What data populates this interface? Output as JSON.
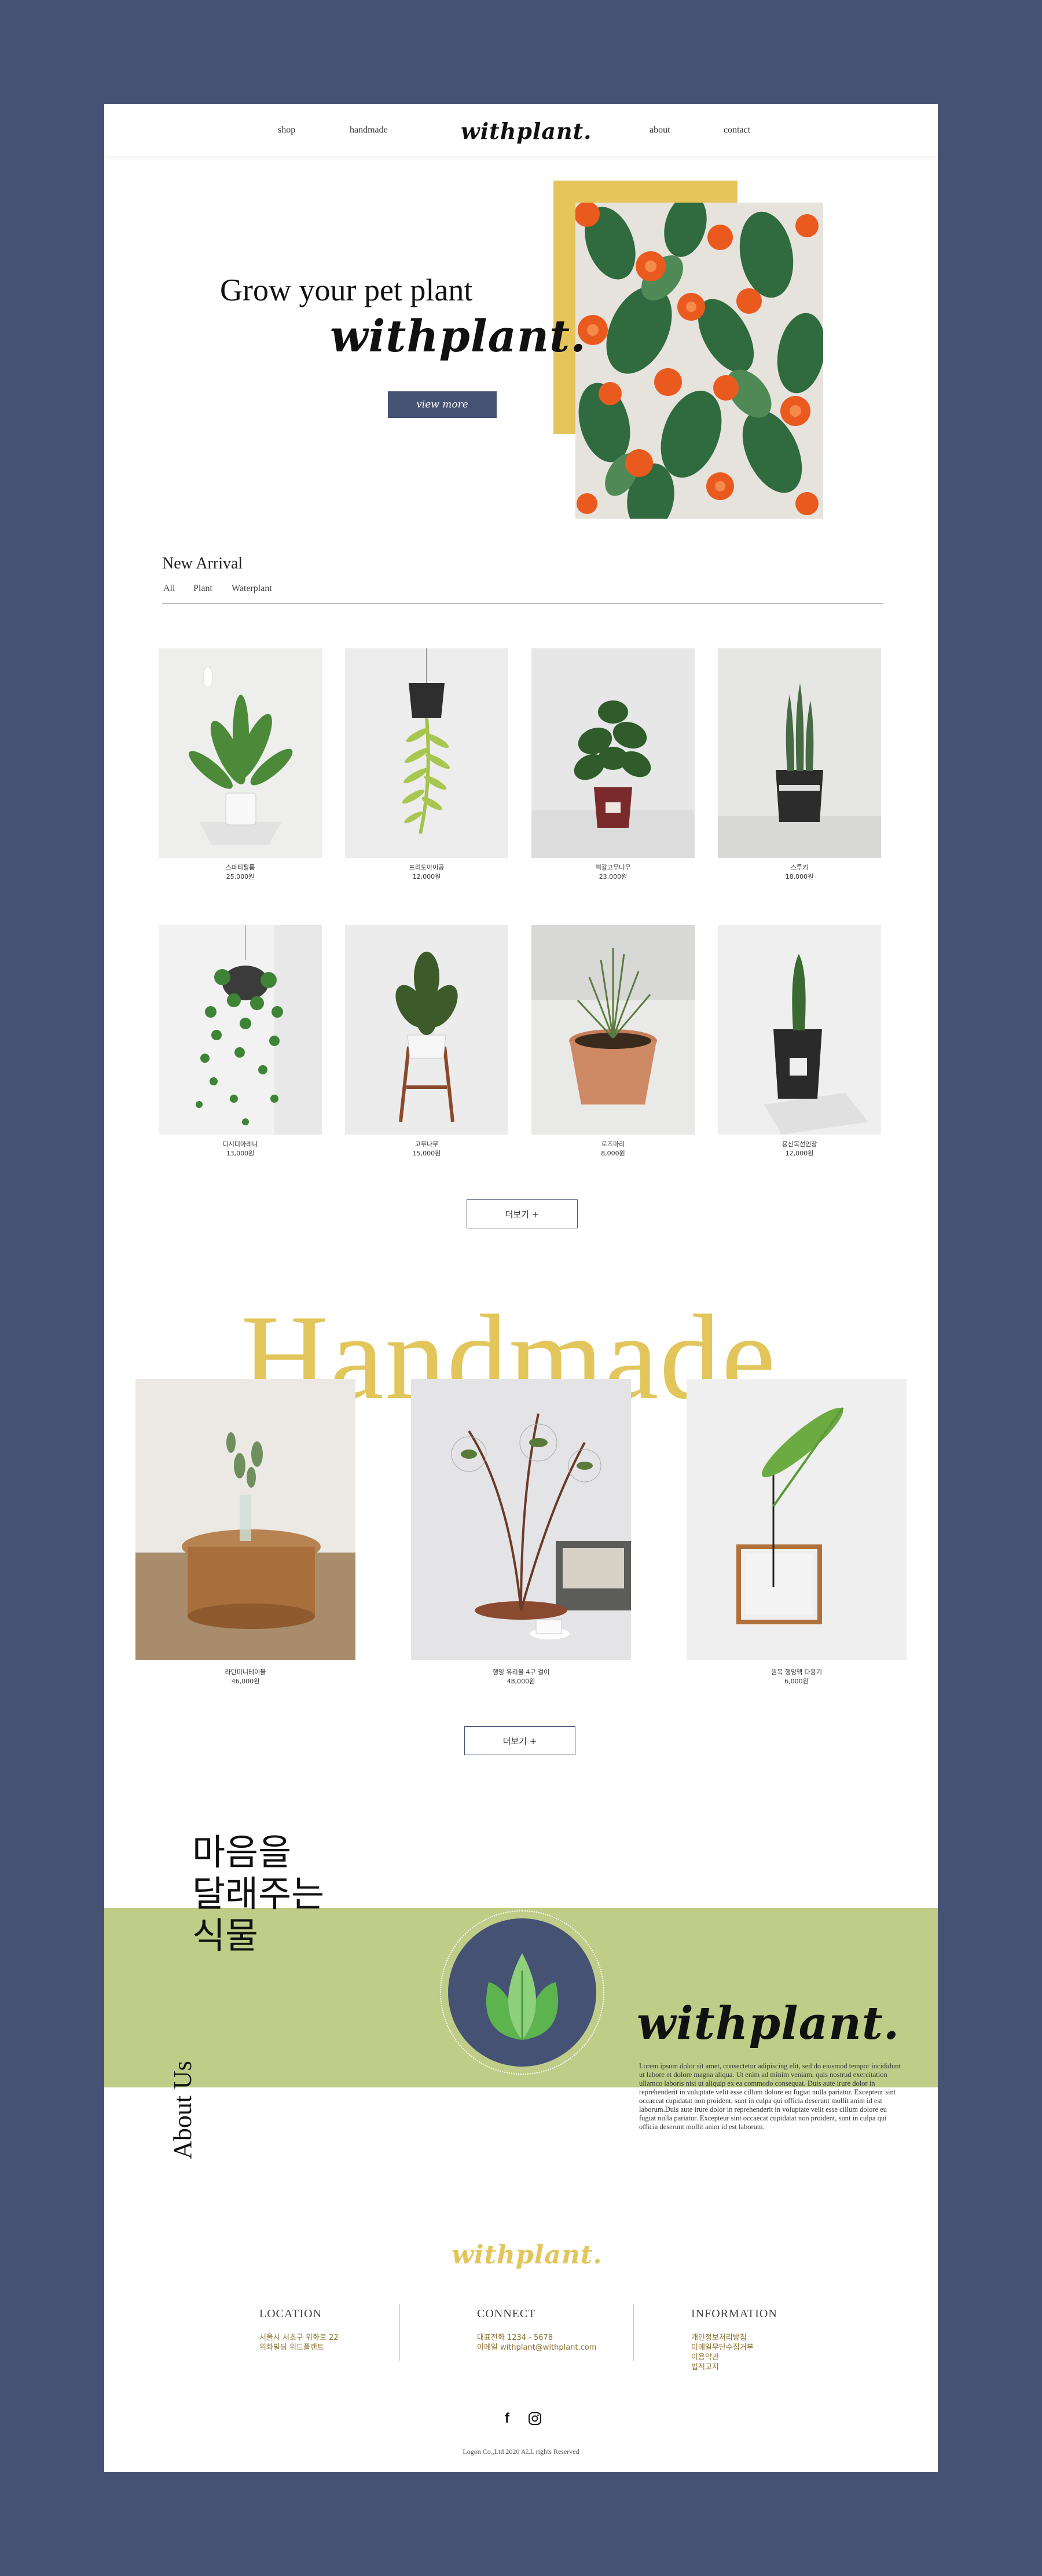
{
  "colors": {
    "navy": "#465274",
    "yellow": "#e2c65c",
    "green_band": "#c0cd88",
    "white": "#ffffff"
  },
  "nav": {
    "links": [
      "shop",
      "handmade",
      "about",
      "contact"
    ],
    "logo": "withplant."
  },
  "hero": {
    "title": "Grow your pet plant",
    "script": "withplant.",
    "button": "view more"
  },
  "new_arrival": {
    "title": "New Arrival",
    "tabs": [
      "All",
      "Plant",
      "Waterplant"
    ],
    "products": [
      {
        "name": "스파티필름",
        "price": "25,000원"
      },
      {
        "name": "프리도아이공",
        "price": "12,000원"
      },
      {
        "name": "떡갈고무나무",
        "price": "23,000원"
      },
      {
        "name": "스투키",
        "price": "18,000원"
      },
      {
        "name": "디시디아레니",
        "price": "13,000원"
      },
      {
        "name": "고무나무",
        "price": "15,000원"
      },
      {
        "name": "로즈마리",
        "price": "8,000원"
      },
      {
        "name": "용신목선인장",
        "price": "12,000원"
      }
    ],
    "more_button": "더보기 +"
  },
  "handmade": {
    "title": "Handmade",
    "items": [
      {
        "name": "라탄미니테이블",
        "price": "46,000원"
      },
      {
        "name": "행잉 유리볼 4구 걸이",
        "price": "48,000원"
      },
      {
        "name": "원목 행잉액 다용기",
        "price": "6,000원"
      }
    ],
    "more_button": "더보기 +"
  },
  "about": {
    "korean_lines": [
      "마음을",
      "달래주는",
      "식물"
    ],
    "vertical": "About Us",
    "logo": "withplant.",
    "lorem": "Lorem ipsum dolor sit amet, consectetur adipiscing elit, sed do eiusmod tempor incididunt ut labore et dolore magna aliqua. Ut enim ad minim veniam, quis nostrud exercitation ullamco laboris nisi ut aliquip ex ea commodo consequat. Duis aute irure dolor in reprehenderit in voluptate velit esse cillum dolore eu fugiat nulla pariatur. Excepteur sint occaecat cupidatat non proident, sunt in culpa qui officia deserunt mollit anim id est laborum.Duis aute irure dolor in reprehenderit in voluptate velit esse cillum dolore eu fugiat nulla pariatur. Excepteur sint occaecat cupidatat non proident, sunt in culpa qui officia deserunt mollit anim id est laborum."
  },
  "footer": {
    "logo": "withplant.",
    "location": {
      "title": "LOCATION",
      "lines": [
        "서울시 서초구 위화로 22",
        "위화빌딩 위드플랜트"
      ]
    },
    "connect": {
      "title": "CONNECT",
      "lines": [
        "대표전화 1234 - 5678",
        "이메일 withplant@withplant.com"
      ]
    },
    "information": {
      "title": "INFORMATION",
      "lines": [
        "개인정보처리방침",
        "이메일무단수집거부",
        "이용약관",
        "법적고지"
      ]
    },
    "social": {
      "facebook": "f",
      "instagram_icon": "instagram-icon"
    },
    "copyright": "Logon Co.,Ltd 2020 ALL rights Reserved"
  }
}
